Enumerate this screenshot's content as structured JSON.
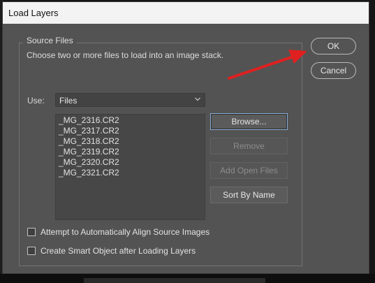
{
  "window": {
    "title": "Load Layers"
  },
  "source_files": {
    "legend": "Source Files",
    "description": "Choose two or more files to load into an image stack.",
    "use_label": "Use:",
    "use_value": "Files",
    "files": [
      "_MG_2316.CR2",
      "_MG_2317.CR2",
      "_MG_2318.CR2",
      "_MG_2319.CR2",
      "_MG_2320.CR2",
      "_MG_2321.CR2"
    ],
    "buttons": {
      "browse": "Browse...",
      "remove": "Remove",
      "add_open_files": "Add Open Files",
      "sort_by_name": "Sort By Name"
    },
    "checkboxes": {
      "auto_align": {
        "label": "Attempt to Automatically Align Source Images",
        "checked": false
      },
      "smart_object": {
        "label": "Create Smart Object after Loading Layers",
        "checked": false
      }
    }
  },
  "dialog_buttons": {
    "ok": "OK",
    "cancel": "Cancel"
  },
  "colors": {
    "dialog_bg": "#535353",
    "annotation_arrow": "#e02020",
    "focus_ring": "#8ab0d8"
  },
  "annotation": {
    "type": "arrow",
    "points_to": "ok-button",
    "color_name": "red"
  }
}
